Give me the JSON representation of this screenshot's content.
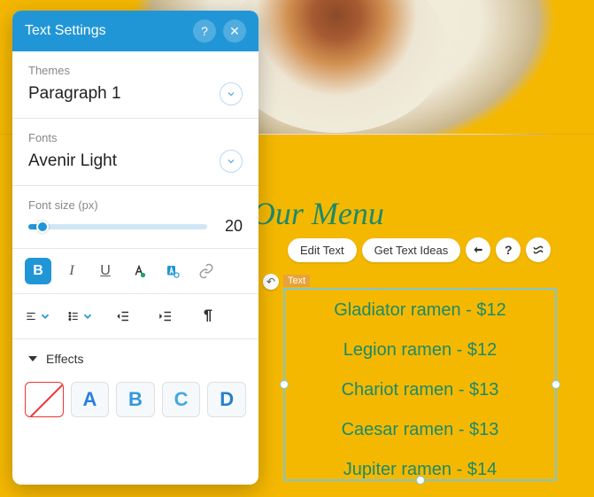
{
  "panel": {
    "title": "Text Settings",
    "themes_label": "Themes",
    "theme_value": "Paragraph 1",
    "fonts_label": "Fonts",
    "font_value": "Avenir Light",
    "size_label": "Font size (px)",
    "size_value": "20",
    "effects_label": "Effects",
    "swatch_letters": {
      "a": "A",
      "b": "B",
      "c": "C",
      "d": "D"
    }
  },
  "canvas": {
    "heading": "Our Menu",
    "edit_text": "Edit Text",
    "get_ideas": "Get Text Ideas",
    "tag": "Text",
    "items": [
      "Gladiator ramen - $12",
      "Legion ramen - $12",
      "Chariot ramen - $13",
      "Caesar ramen - $13",
      "Jupiter ramen - $14"
    ]
  }
}
